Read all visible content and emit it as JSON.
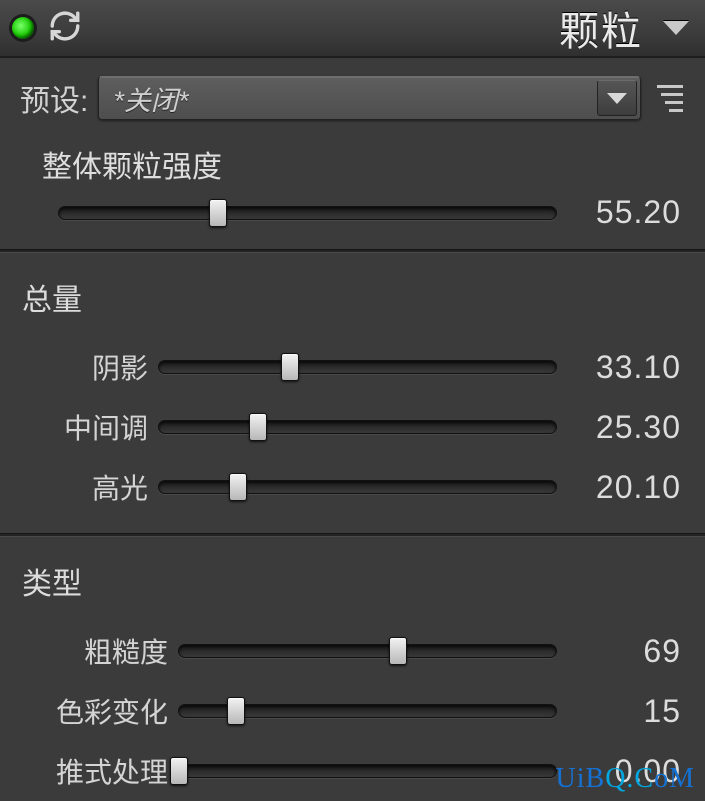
{
  "header": {
    "title": "颗粒"
  },
  "preset": {
    "label": "预设:",
    "value": "*关闭*"
  },
  "overall": {
    "label": "整体颗粒强度",
    "value": "55.20",
    "percent": 32
  },
  "amount": {
    "heading": "总量",
    "sliders": [
      {
        "label": "阴影",
        "value": "33.10",
        "percent": 33
      },
      {
        "label": "中间调",
        "value": "25.30",
        "percent": 25
      },
      {
        "label": "高光",
        "value": "20.10",
        "percent": 20
      }
    ]
  },
  "type_group": {
    "heading": "类型",
    "sliders": [
      {
        "label": "粗糙度",
        "value": "69",
        "percent": 58
      },
      {
        "label": "色彩变化",
        "value": "15",
        "percent": 15
      },
      {
        "label": "推式处理",
        "value": "0.00",
        "percent": 0
      }
    ]
  },
  "watermark": {
    "part1": "UiB",
    "part2": "Q.C",
    "part3": "oM"
  }
}
